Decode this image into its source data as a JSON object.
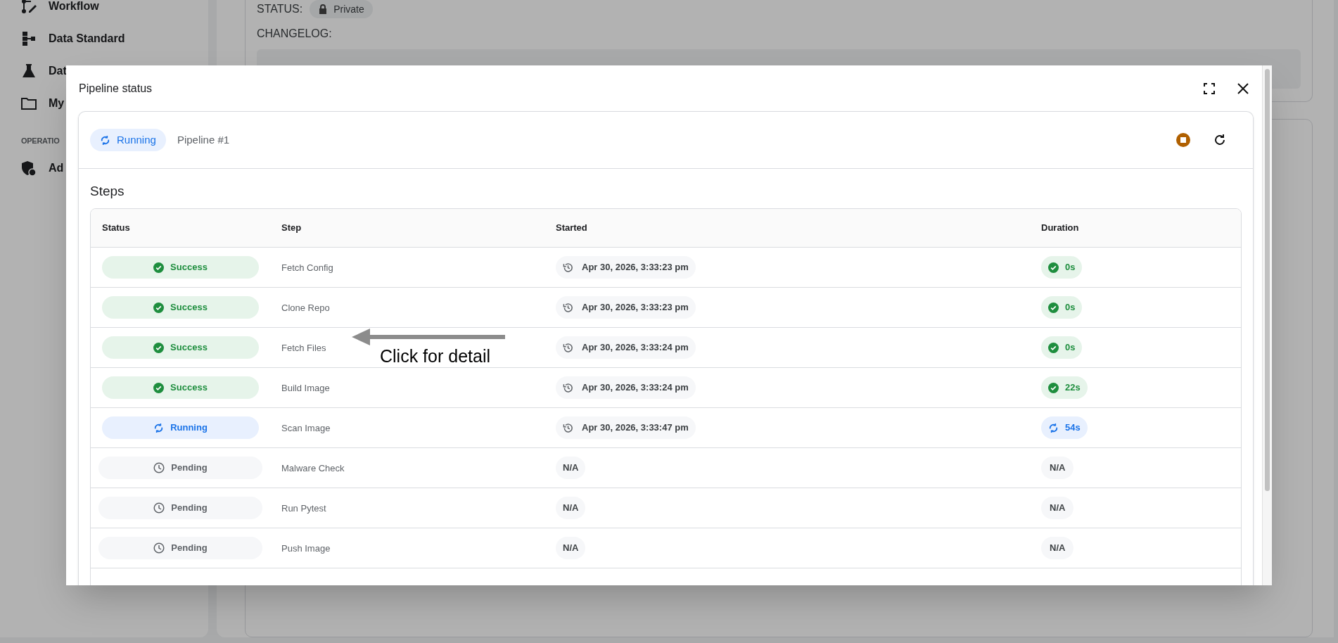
{
  "background": {
    "sidebar": {
      "items": [
        {
          "label": "Workflow"
        },
        {
          "label": "Data Standard"
        },
        {
          "label": "Dat"
        },
        {
          "label": "My"
        }
      ],
      "section": "OPERATIO",
      "section_items": [
        {
          "label": "Ad"
        }
      ]
    },
    "main": {
      "status_label": "STATUS:",
      "status_value": "Private",
      "changelog_label": "CHANGELOG:"
    }
  },
  "dialog": {
    "title": "Pipeline status",
    "pipeline": {
      "kind": "running",
      "status_label": "Running",
      "name": "Pipeline #1"
    },
    "steps_title": "Steps",
    "table": {
      "columns": [
        "Status",
        "Step",
        "Started",
        "Duration"
      ],
      "rows": [
        {
          "kind": "success",
          "status_label": "Success",
          "step": "Fetch Config",
          "started": "Apr 30, 2026, 3:33:23 pm",
          "duration": "0s"
        },
        {
          "kind": "success",
          "status_label": "Success",
          "step": "Clone Repo",
          "started": "Apr 30, 2026, 3:33:23 pm",
          "duration": "0s"
        },
        {
          "kind": "success",
          "status_label": "Success",
          "step": "Fetch Files",
          "started": "Apr 30, 2026, 3:33:24 pm",
          "duration": "0s"
        },
        {
          "kind": "success",
          "status_label": "Success",
          "step": "Build Image",
          "started": "Apr 30, 2026, 3:33:24 pm",
          "duration": "22s"
        },
        {
          "kind": "running",
          "status_label": "Running",
          "step": "Scan Image",
          "started": "Apr 30, 2026, 3:33:47 pm",
          "duration": "54s"
        },
        {
          "kind": "pending",
          "status_label": "Pending",
          "step": "Malware Check",
          "started": "N/A",
          "duration": "N/A"
        },
        {
          "kind": "pending",
          "status_label": "Pending",
          "step": "Run Pytest",
          "started": "N/A",
          "duration": "N/A"
        },
        {
          "kind": "pending",
          "status_label": "Pending",
          "step": "Push Image",
          "started": "N/A",
          "duration": "N/A"
        }
      ]
    }
  },
  "annotation": {
    "text": "Click for detail"
  }
}
